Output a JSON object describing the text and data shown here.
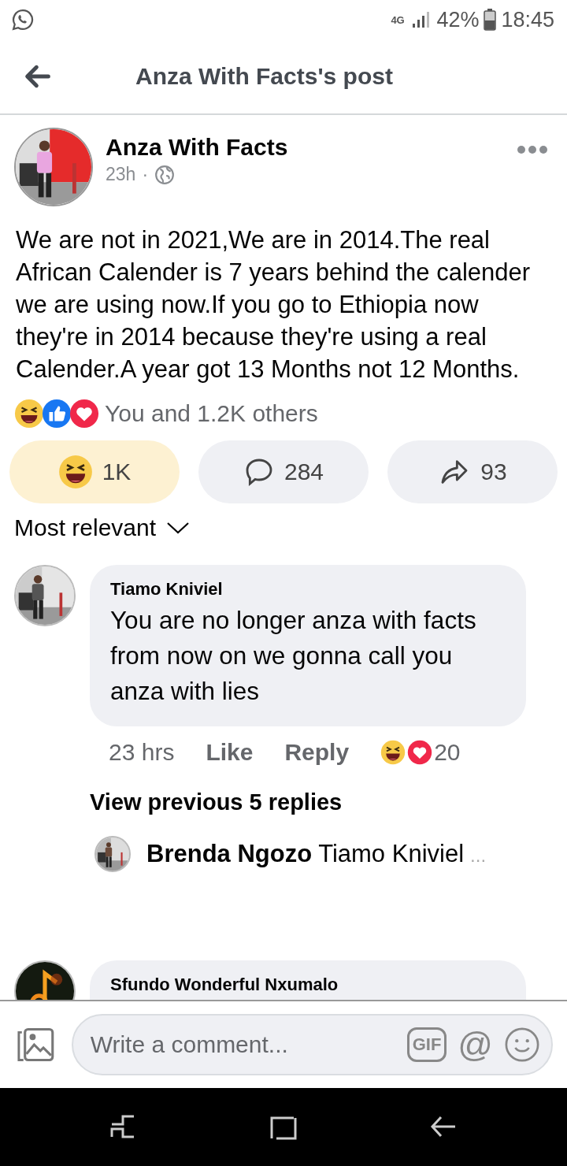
{
  "status_bar": {
    "network": "4G",
    "battery": "42%",
    "time": "18:45"
  },
  "header": {
    "title": "Anza With Facts's post"
  },
  "post": {
    "author": "Anza With Facts",
    "time": "23h",
    "separator": "·",
    "text": "We are not in 2021,We are in 2014.The real African Calender is 7 years behind the calender we are using now.If you go to Ethiopia now they're in 2014 because they're using a real Calender.A year got 13 Months not 12 Months.",
    "reactions_summary": "You and 1.2K others",
    "actions": [
      {
        "kind": "react",
        "label": "1K",
        "selected": true
      },
      {
        "kind": "comment",
        "label": "284",
        "selected": false
      },
      {
        "kind": "share",
        "label": "93",
        "selected": false
      }
    ]
  },
  "sort": {
    "label": "Most relevant"
  },
  "comments": [
    {
      "author": "Tiamo Kniviel",
      "text": "You are no longer anza with facts from now on we gonna call you anza with lies",
      "time": "23 hrs",
      "like": "Like",
      "reply": "Reply",
      "reaction_count": "20",
      "view_replies": "View previous 5 replies",
      "latest_reply": {
        "author": "Brenda Ngozo",
        "text": "Tiamo Kniviel",
        "more": "..."
      }
    },
    {
      "author": "Sfundo Wonderful Nxumalo"
    }
  ],
  "composer": {
    "placeholder": "Write a comment...",
    "gif": "GIF",
    "mention": "@"
  }
}
